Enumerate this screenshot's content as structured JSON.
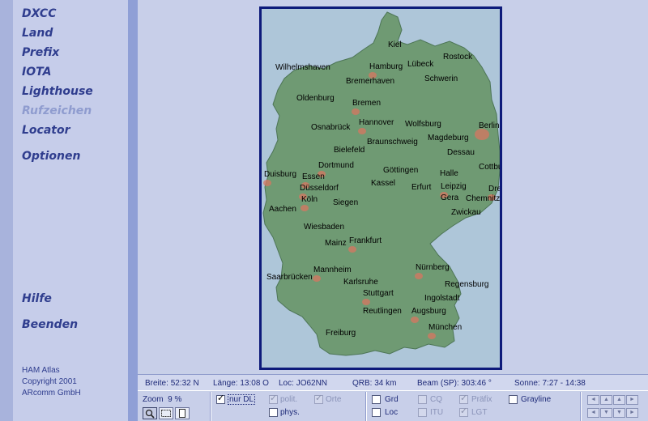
{
  "sidebar": {
    "items": [
      {
        "label": "DXCC",
        "enabled": true
      },
      {
        "label": "Land",
        "enabled": true
      },
      {
        "label": "Prefix",
        "enabled": true
      },
      {
        "label": "IOTA",
        "enabled": true
      },
      {
        "label": "Lighthouse",
        "enabled": true
      },
      {
        "label": "Rufzeichen",
        "enabled": false
      },
      {
        "label": "Locator",
        "enabled": true
      },
      {
        "label": "Optionen",
        "enabled": true
      }
    ],
    "bottom_items": [
      {
        "label": "Hilfe"
      },
      {
        "label": "Beenden"
      }
    ],
    "footer": {
      "line1": "HAM Atlas",
      "line2": "Copyright 2001",
      "line3": "ARcomm GmbH"
    }
  },
  "map": {
    "cities": [
      "Kiel",
      "Rostock",
      "Lübeck",
      "Hamburg",
      "Wilhelmshaven",
      "Bremerhaven",
      "Schwerin",
      "Oldenburg",
      "Bremen",
      "Hannover",
      "Wolfsburg",
      "Berlin",
      "Osnabrück",
      "Braunschweig",
      "Magdeburg",
      "Bielefeld",
      "Dessau",
      "Dortmund",
      "Cottbus",
      "Duisburg",
      "Essen",
      "Göttingen",
      "Halle",
      "Düsseldorf",
      "Kassel",
      "Erfurt",
      "Leipzig",
      "Dresden",
      "Köln",
      "Siegen",
      "Gera",
      "Chemnitz",
      "Aachen",
      "Zwickau",
      "Wiesbaden",
      "Frankfurt",
      "Mainz",
      "Nürnberg",
      "Mannheim",
      "Saarbrücken",
      "Regensburg",
      "Karlsruhe",
      "Stuttgart",
      "Ingolstadt",
      "Reutlingen",
      "Augsburg",
      "München",
      "Freiburg"
    ],
    "colors": {
      "land": "#6f9a73",
      "water": "#aec6d9",
      "frame": "#0d1a7a",
      "urban": "#d77560"
    }
  },
  "status": {
    "breite_label": "Breite:",
    "breite_value": "52:32 N",
    "laenge_label": "Länge:",
    "laenge_value": "13:08 O",
    "loc_label": "Loc:",
    "loc_value": "JO62NN",
    "qrb_label": "QRB:",
    "qrb_value": "34 km",
    "beam_label": "Beam (SP):",
    "beam_value": "303:46 °",
    "sonne_label": "Sonne:",
    "sonne_value": "7:27 - 14:38"
  },
  "controls": {
    "zoom_label": "Zoom",
    "zoom_value": "9 %",
    "nur_dl": {
      "label": "nur DL",
      "checked": true,
      "enabled": true
    },
    "polit": {
      "label": "polit.",
      "checked": true,
      "enabled": false
    },
    "orte": {
      "label": "Orte",
      "checked": true,
      "enabled": false
    },
    "phys": {
      "label": "phys.",
      "checked": false,
      "enabled": true
    },
    "grd": {
      "label": "Grd",
      "checked": false,
      "enabled": true
    },
    "loc": {
      "label": "Loc",
      "checked": false,
      "enabled": true
    },
    "cq": {
      "label": "CQ",
      "checked": false,
      "enabled": false
    },
    "itu": {
      "label": "ITU",
      "checked": false,
      "enabled": false
    },
    "prefix": {
      "label": "Präfix",
      "checked": true,
      "enabled": false
    },
    "lgt": {
      "label": "LGT",
      "checked": true,
      "enabled": false
    },
    "grayline": {
      "label": "Grayline",
      "checked": false,
      "enabled": true
    },
    "tick_symbol": "✓",
    "nav_arrows": [
      "◄",
      "▲",
      "►",
      "▼"
    ]
  }
}
